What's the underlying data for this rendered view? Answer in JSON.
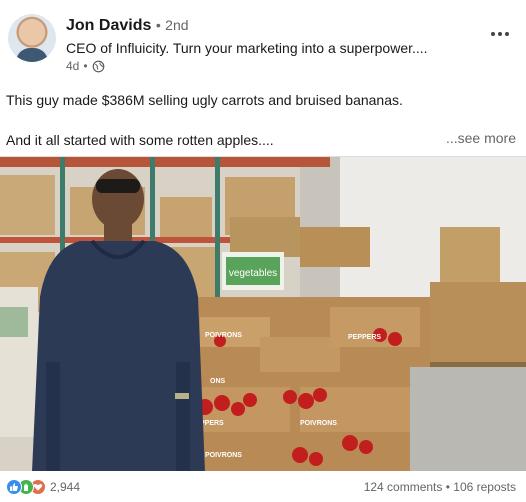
{
  "post": {
    "author": {
      "name": "Jon Davids",
      "separator": "•",
      "degree": "2nd",
      "headline": "CEO of Influicity. Turn your marketing into a superpower....",
      "age": "4d",
      "visibility_icon": "globe-icon"
    },
    "menu_icon": "more-horizontal-icon",
    "text_line1": "This guy made $386M selling ugly carrots and bruised bananas.",
    "text_line2": "And it all started with some rotten apples....",
    "see_more_label": "...see more",
    "photo": {
      "box_label": "vegetables",
      "printed_words": [
        "POIVRONS",
        "PEPPERS",
        "ONS",
        "PPERS"
      ]
    },
    "social": {
      "reaction_icons": [
        "like-icon",
        "celebrate-icon",
        "love-icon"
      ],
      "reactions_count": "2,944",
      "comments": "124 comments",
      "stats_separator": "•",
      "reposts": "106 reposts"
    }
  },
  "colors": {
    "text_primary": "#191919",
    "text_secondary": "#666666",
    "like": "#378fe9",
    "celebrate": "#44b24d",
    "love": "#df704d"
  }
}
